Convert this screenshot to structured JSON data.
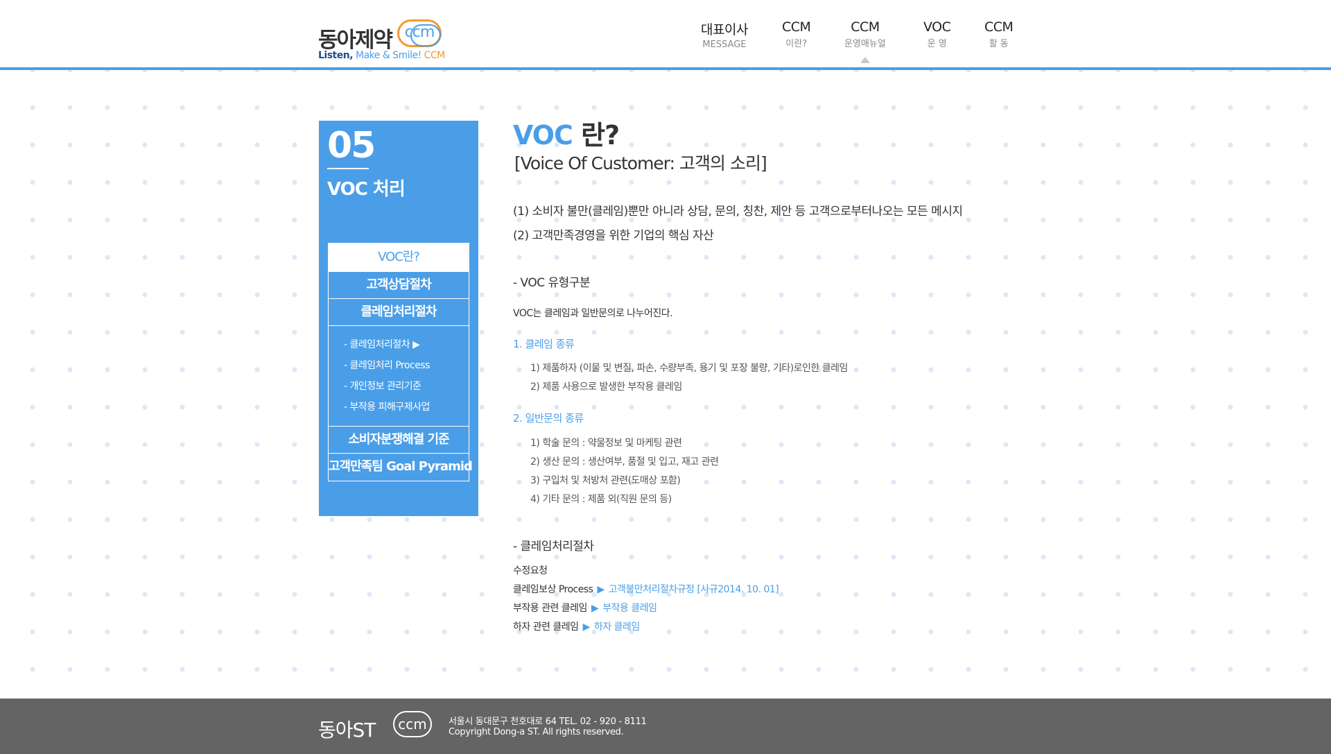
{
  "header": {
    "logo": {
      "brand": "동아제약",
      "mark": "ccm",
      "tagline_a": "Listen,",
      "tagline_b": "Make & Smile!",
      "tagline_c": "CCM"
    },
    "nav": [
      {
        "main": "대표이사",
        "sub": "MESSAGE"
      },
      {
        "main": "CCM",
        "sub": "이란?"
      },
      {
        "main": "CCM",
        "sub": "운영매뉴얼"
      },
      {
        "main": "VOC",
        "sub": "운 영"
      },
      {
        "main": "CCM",
        "sub": "활 동"
      }
    ],
    "active_nav_index": 2
  },
  "sidebar": {
    "number": "05",
    "title": "VOC 처리",
    "menu": [
      {
        "label": "VOC란?"
      },
      {
        "label": "고객상담절차"
      },
      {
        "label": "클레임처리절차"
      },
      {
        "label": "소비자분쟁해결 기준"
      },
      {
        "label": "고객만족팀 Goal Pyramid"
      }
    ],
    "submenu": [
      {
        "label": "- 클레임처리절차  ▶"
      },
      {
        "label": "- 클레임처리 Process"
      },
      {
        "label": "- 개인정보 관리기준"
      },
      {
        "label": "- 부작용 피해구제사업"
      }
    ]
  },
  "content": {
    "title_em": "VOC",
    "title_rest": " 란?",
    "subtitle": "[Voice Of Customer: 고객의 소리]",
    "def1": "(1) 소비자 불만(클레임)뿐만 아니라 상담, 문의, 칭찬, 제안 등 고객으로부터나오는 모든 메시지",
    "def2": "(2) 고객만족경영을 위한 기업의 핵심 자산",
    "section1_title": "- VOC 유형구분",
    "section1_intro": "VOC는 클레임과 일반문의로 나누어진다.",
    "claim_title": "1. 클레임 종류",
    "claim_items": [
      "1) 제품하자 (이물 및 변질, 파손, 수량부족, 용기 및 포장 불량, 기타)로인한 클레임",
      "2) 제품 사용으로 발생한 부작용 클레임"
    ],
    "inquiry_title": "2. 일반문의 종류",
    "inquiry_items": [
      "1) 학술 문의 : 약물정보 및 마케팅 관련",
      "2) 생산 문의 : 생산여부, 품절 및 입고, 재고 관련",
      "3) 구입처 및 처방처 관련(도매상 포함)",
      "4) 기타 문의 : 제품 외(직원 문의 등)"
    ],
    "section2_title": "- 클레임처리절차",
    "section2_intro": "수정요청",
    "process_rows": [
      {
        "label": "클레임보상 Process",
        "arrow": "▶",
        "link": "고객불만처리절차규정 [사규2014. 10. 01]"
      },
      {
        "label": "부작용 관련 클레임",
        "arrow": "▶",
        "link": "부작용 클레임"
      },
      {
        "label": "하자 관련 클레임",
        "arrow": "▶",
        "link": "하자 클레임"
      }
    ]
  },
  "footer": {
    "logo_word": "동아ST",
    "logo_mark": "ccm",
    "address": "서울시 동대문구 천호대로 64 TEL. 02 - 920 - 8111",
    "copyright": "Copyright Dong-a ST. All rights reserved."
  },
  "colors": {
    "accent": "#4a9ee8",
    "orange": "#f39a2d",
    "footer": "#646464"
  }
}
